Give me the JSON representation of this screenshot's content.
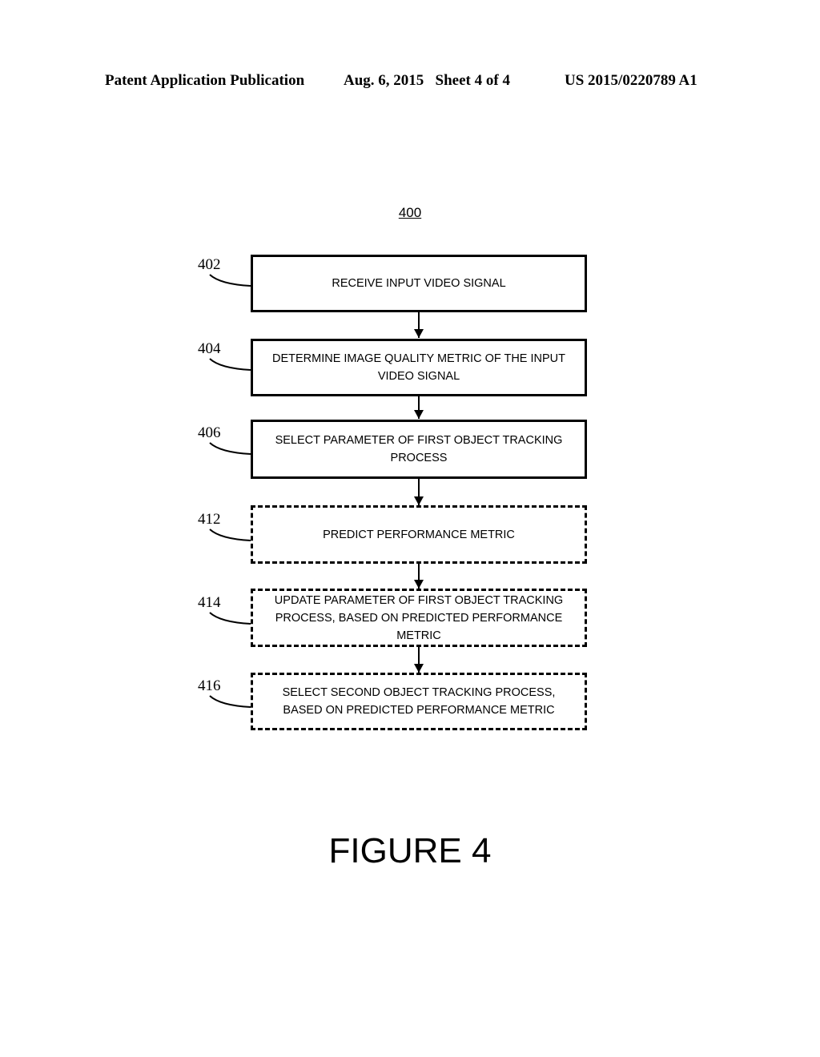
{
  "header": {
    "publication": "Patent Application Publication",
    "date_sheet": "Aug. 6, 2015   Sheet 4 of 4",
    "number": "US 2015/0220789 A1"
  },
  "figure": {
    "reference": "400",
    "title": "FIGURE 4"
  },
  "steps": [
    {
      "ref": "402",
      "text": "RECEIVE INPUT VIDEO SIGNAL",
      "style": "solid"
    },
    {
      "ref": "404",
      "text": "DETERMINE IMAGE QUALITY METRIC OF THE INPUT VIDEO SIGNAL",
      "style": "solid"
    },
    {
      "ref": "406",
      "text": "SELECT PARAMETER OF FIRST OBJECT TRACKING PROCESS",
      "style": "solid"
    },
    {
      "ref": "412",
      "text": "PREDICT PERFORMANCE METRIC",
      "style": "dashed"
    },
    {
      "ref": "414",
      "text": "UPDATE PARAMETER OF FIRST OBJECT TRACKING PROCESS, BASED ON PREDICTED PERFORMANCE METRIC",
      "style": "dashed"
    },
    {
      "ref": "416",
      "text": "SELECT SECOND OBJECT TRACKING PROCESS, BASED ON PREDICTED PERFORMANCE METRIC",
      "style": "dashed"
    }
  ]
}
